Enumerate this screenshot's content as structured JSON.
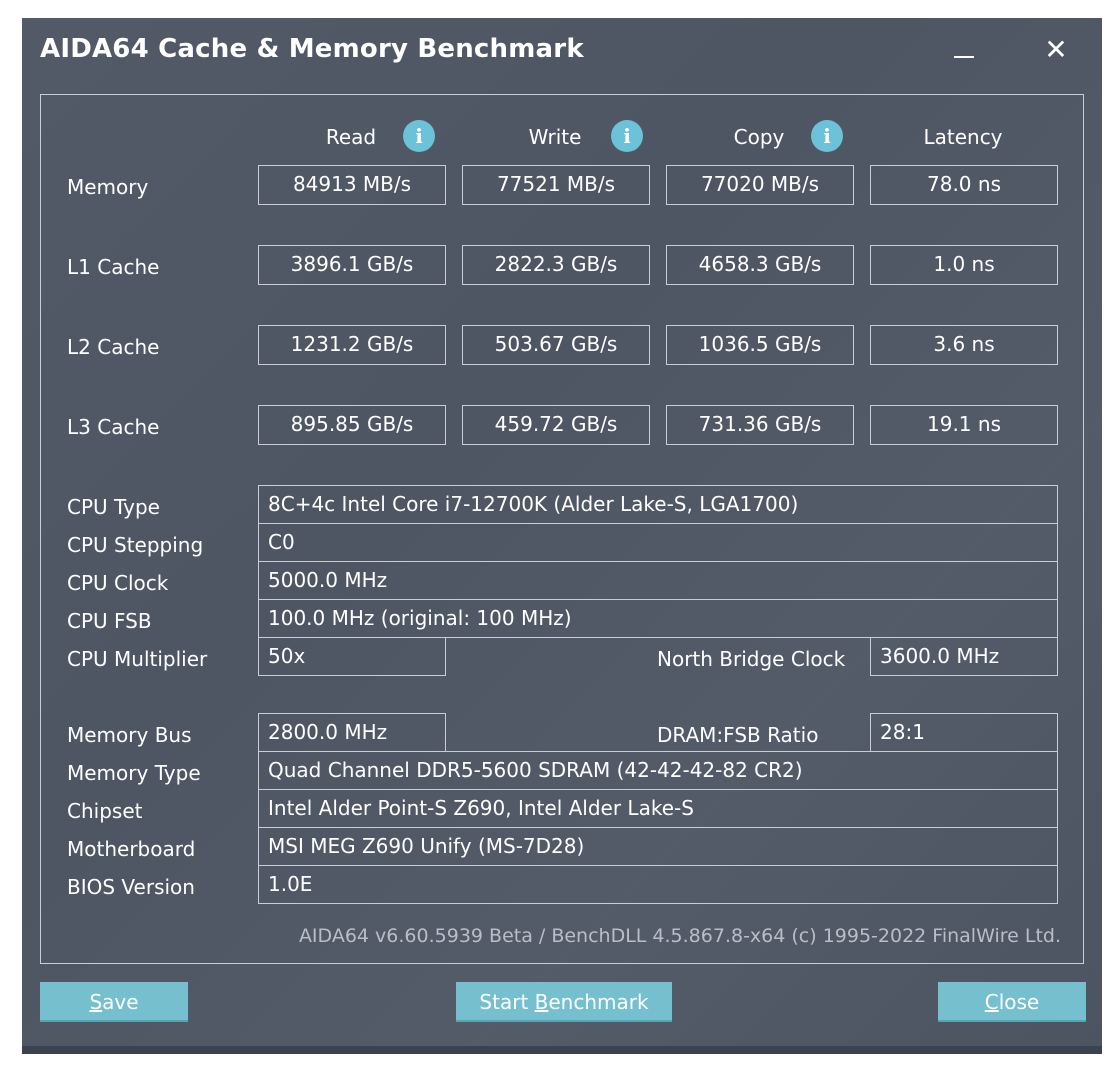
{
  "window": {
    "title": "AIDA64 Cache & Memory Benchmark",
    "minimize_glyph": "",
    "close_glyph": "✕"
  },
  "columns": [
    "Read",
    "Write",
    "Copy",
    "Latency"
  ],
  "info_glyph": "i",
  "bench_rows": [
    {
      "label": "Memory",
      "values": [
        "84913 MB/s",
        "77521 MB/s",
        "77020 MB/s",
        "78.0 ns"
      ]
    },
    {
      "label": "L1 Cache",
      "values": [
        "3896.1 GB/s",
        "2822.3 GB/s",
        "4658.3 GB/s",
        "1.0 ns"
      ]
    },
    {
      "label": "L2 Cache",
      "values": [
        "1231.2 GB/s",
        "503.67 GB/s",
        "1036.5 GB/s",
        "3.6 ns"
      ]
    },
    {
      "label": "L3 Cache",
      "values": [
        "895.85 GB/s",
        "459.72 GB/s",
        "731.36 GB/s",
        "19.1 ns"
      ]
    }
  ],
  "cpu": {
    "type_label": "CPU Type",
    "type_value": "8C+4c Intel Core i7-12700K  (Alder Lake-S, LGA1700)",
    "stepping_label": "CPU Stepping",
    "stepping_value": "C0",
    "clock_label": "CPU Clock",
    "clock_value": "5000.0 MHz",
    "fsb_label": "CPU FSB",
    "fsb_value": "100.0 MHz  (original: 100 MHz)",
    "multiplier_label": "CPU Multiplier",
    "multiplier_value": "50x",
    "nb_clock_label": "North Bridge Clock",
    "nb_clock_value": "3600.0 MHz"
  },
  "memory": {
    "bus_label": "Memory Bus",
    "bus_value": "2800.0 MHz",
    "ratio_label": "DRAM:FSB Ratio",
    "ratio_value": "28:1",
    "type_label": "Memory Type",
    "type_value": "Quad Channel DDR5-5600 SDRAM  (42-42-42-82 CR2)",
    "chipset_label": "Chipset",
    "chipset_value": "Intel Alder Point-S Z690, Intel Alder Lake-S",
    "motherboard_label": "Motherboard",
    "motherboard_value": "MSI MEG Z690 Unify (MS-7D28)",
    "bios_label": "BIOS Version",
    "bios_value": "1.0E"
  },
  "footer": "AIDA64 v6.60.5939 Beta / BenchDLL 4.5.867.8-x64  (c) 1995-2022 FinalWire Ltd.",
  "buttons": {
    "save_mnemonic": "S",
    "save_rest": "ave",
    "start_prefix": "Start ",
    "start_mnemonic": "B",
    "start_rest": "enchmark",
    "close_mnemonic": "C",
    "close_rest": "lose"
  },
  "colors": {
    "window_bg": "#4e5664",
    "border": "#c9ced6",
    "button_bg": "#75bfcf",
    "info_icon": "#6cc2d8"
  }
}
